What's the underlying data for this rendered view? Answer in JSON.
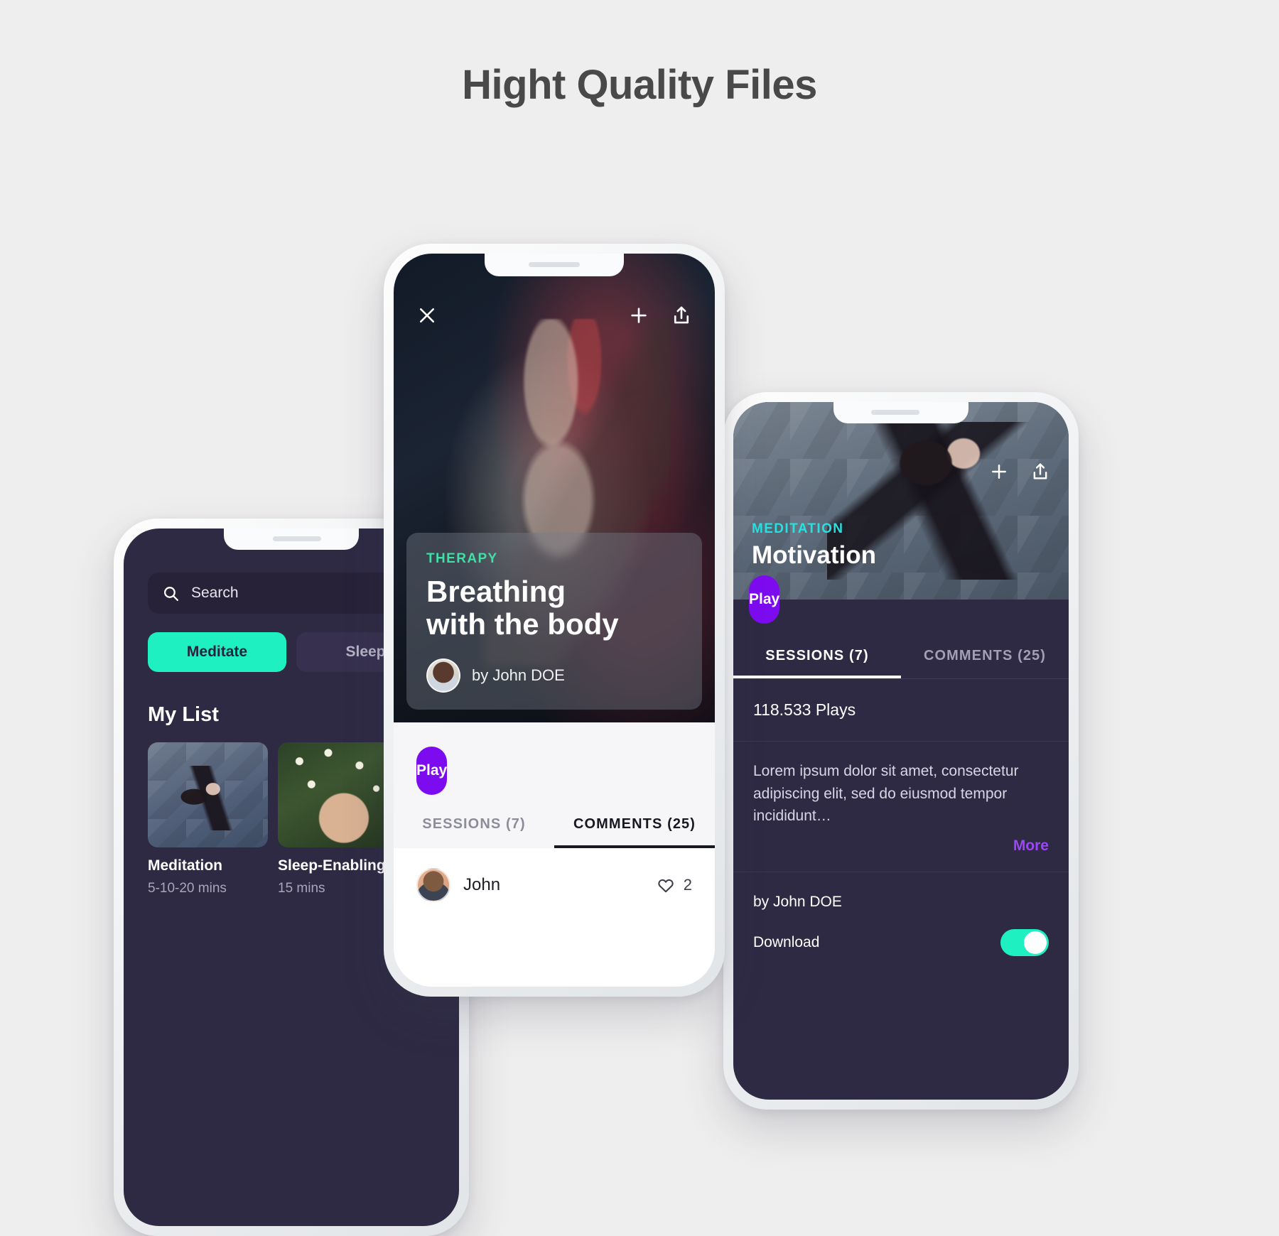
{
  "page": {
    "title": "Hight Quality Files",
    "background_color": "#efeeee",
    "title_color": "#494949"
  },
  "colors": {
    "accent_purple": "#7d0bf0",
    "accent_teal": "#1ef0c1",
    "accent_cyan": "#24e2e2",
    "accent_mint": "#3fdfa5",
    "dark_surface": "#2e2a44",
    "more_link": "#9b47f5"
  },
  "left_phone": {
    "name": "browse-screen",
    "search": {
      "icon": "search-icon",
      "placeholder": "Search",
      "value": "Search"
    },
    "segments": [
      {
        "label": "Meditate",
        "state": "active"
      },
      {
        "label": "Sleep",
        "state": "inactive"
      }
    ],
    "section_title": "My List",
    "cards": [
      {
        "title": "Meditation",
        "duration": "5-10-20 mins",
        "image": "yoga-pose-thumbnail"
      },
      {
        "title": "Sleep-Enabling",
        "duration": "15 mins",
        "image": "flowers-portrait-thumbnail"
      }
    ]
  },
  "center_phone": {
    "name": "track-detail-screen",
    "icons": {
      "close": "close-icon",
      "add": "plus-icon",
      "share": "share-icon"
    },
    "hero_image": "buddha-statue-photo",
    "info_card": {
      "category": "THERAPY",
      "title_line1": "Breathing",
      "title_line2": "with the body",
      "author": "by John DOE",
      "avatar": "author-avatar"
    },
    "play_label": "Play",
    "tabs": [
      {
        "label": "SESSIONS (7)",
        "state": "inactive"
      },
      {
        "label": "COMMENTS (25)",
        "state": "active"
      }
    ],
    "comment": {
      "avatar": "commenter-avatar",
      "name": "John",
      "likes": "2",
      "like_icon": "heart-icon"
    }
  },
  "right_phone": {
    "name": "session-detail-screen",
    "icons": {
      "add": "plus-icon",
      "share": "share-icon"
    },
    "hero_image": "yoga-pose-photo",
    "category": "MEDITATION",
    "title": "Motivation",
    "play_label": "Play",
    "tabs": [
      {
        "label": "SESSIONS (7)",
        "state": "active"
      },
      {
        "label": "COMMENTS (25)",
        "state": "inactive"
      }
    ],
    "plays": "118.533 Plays",
    "description": "Lorem ipsum dolor sit amet, consectetur adipiscing elit, sed do eiusmod tempor incididunt…",
    "more_label": "More",
    "author": "by John DOE",
    "download_label": "Download",
    "download_toggle": "on"
  }
}
